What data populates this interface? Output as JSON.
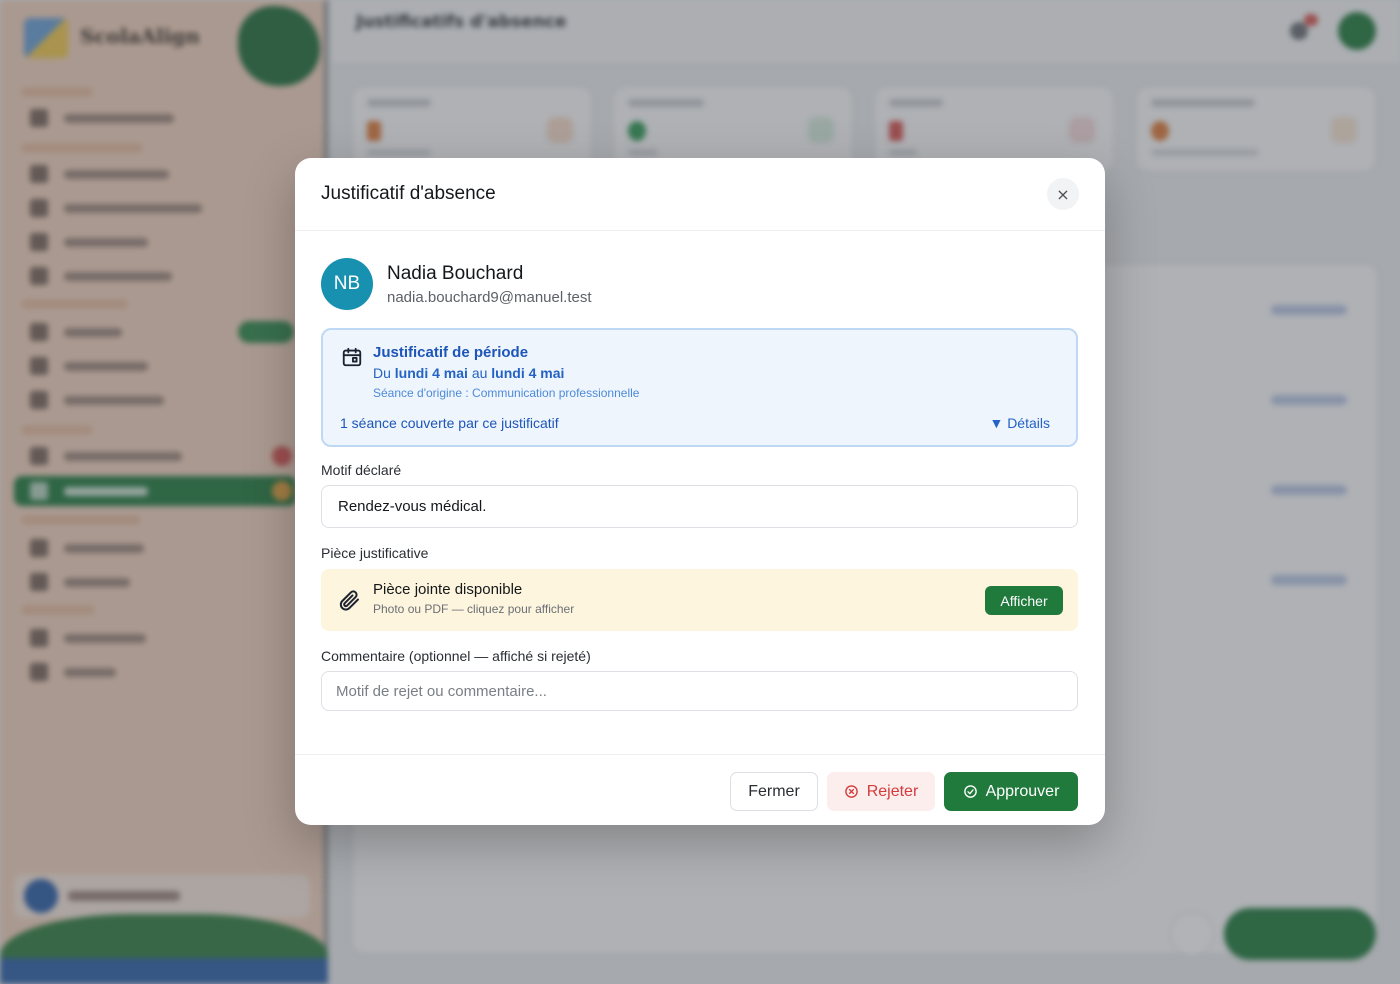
{
  "background": {
    "brand": {
      "name": "ScolaAlign",
      "subtitle": ""
    },
    "topbar": {
      "title": "Justificatifs d'absence",
      "subtitle": ""
    }
  },
  "modal": {
    "title": "Justificatif d'absence",
    "close_icon": "×",
    "student": {
      "initials": "NB",
      "name": "Nadia Bouchard",
      "email": "nadia.bouchard9@manuel.test"
    },
    "period": {
      "title": "Justificatif de période",
      "range_prefix": "Du",
      "range_start": "lundi 4 mai",
      "range_middle": "au",
      "range_end": "lundi 4 mai",
      "origin": "Séance d'origine : Communication professionnelle",
      "covered": "1 séance couverte par ce justificatif",
      "details_label": "▼ Détails"
    },
    "motif": {
      "label": "Motif déclaré",
      "value": "Rendez-vous médical."
    },
    "attachment": {
      "label": "Pièce justificative",
      "title": "Pièce jointe disponible",
      "subtitle": "Photo ou PDF — cliquez pour afficher",
      "button": "Afficher"
    },
    "comment": {
      "label": "Commentaire (optionnel — affiché si rejeté)",
      "placeholder": "Motif de rejet ou commentaire...",
      "value": ""
    },
    "footer": {
      "close_label": "Fermer",
      "reject_label": "Rejeter",
      "approve_label": "Approuver"
    }
  },
  "colors": {
    "accent_green": "#1f7a3c",
    "info_blue": "#1d55b8",
    "danger_red": "#d43b3b",
    "avatar_teal": "#1890b0"
  },
  "icons": [
    "calendar-icon",
    "paperclip-icon",
    "close-icon",
    "reject-icon",
    "approve-icon"
  ]
}
